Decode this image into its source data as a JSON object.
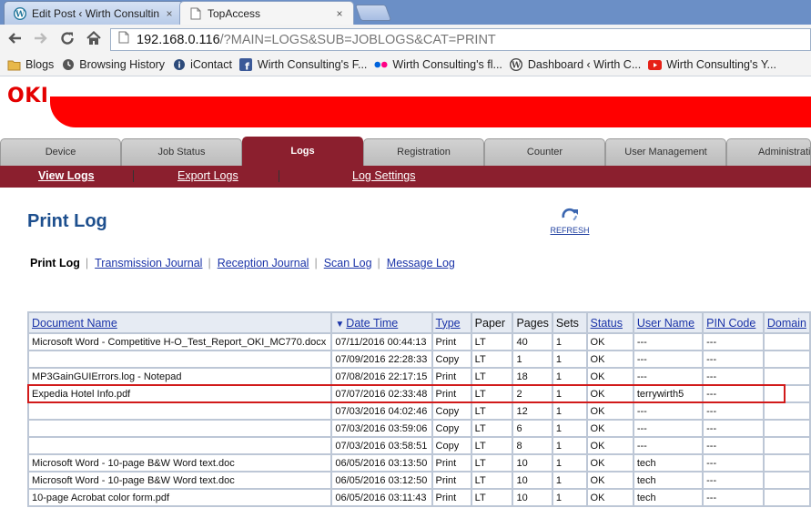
{
  "browser": {
    "tabs": [
      {
        "label": "Edit Post ‹ Wirth Consultin",
        "icon": "wordpress-icon"
      },
      {
        "label": "TopAccess",
        "icon": "page-icon"
      }
    ],
    "close_glyph": "×",
    "url_host": "192.168.0.116",
    "url_path": "/?MAIN=LOGS&SUB=JOBLOGS&CAT=PRINT",
    "bookmarks": [
      {
        "label": "Blogs",
        "icon": "folder-icon"
      },
      {
        "label": "Browsing History",
        "icon": "clock-icon"
      },
      {
        "label": "iContact",
        "icon": "icontact-icon"
      },
      {
        "label": "Wirth Consulting's F...",
        "icon": "facebook-icon"
      },
      {
        "label": "Wirth Consulting's fl...",
        "icon": "flickr-icon"
      },
      {
        "label": "Dashboard ‹ Wirth C...",
        "icon": "wordpress-icon"
      },
      {
        "label": "Wirth Consulting's Y...",
        "icon": "youtube-icon"
      }
    ]
  },
  "brand": {
    "logo": "OKI",
    "color": "#e40000",
    "bar_color": "#ff0000"
  },
  "main_tabs": [
    {
      "label": "Device"
    },
    {
      "label": "Job Status"
    },
    {
      "label": "Logs",
      "active": true
    },
    {
      "label": "Registration"
    },
    {
      "label": "Counter"
    },
    {
      "label": "User Management"
    },
    {
      "label": "Administration"
    }
  ],
  "sub_nav": [
    {
      "label": "View Logs",
      "active": true
    },
    {
      "label": "Export Logs"
    },
    {
      "label": "Log Settings"
    }
  ],
  "page_title": "Print Log",
  "refresh_label": "REFRESH",
  "log_types": {
    "current": "Print Log",
    "links": [
      "Transmission Journal",
      "Reception Journal",
      "Scan Log",
      "Message Log"
    ]
  },
  "table": {
    "columns": [
      {
        "label": "Document Name",
        "link": true
      },
      {
        "label": "Date Time",
        "link": true,
        "sorted": true
      },
      {
        "label": "Type",
        "link": true
      },
      {
        "label": "Paper",
        "link": false
      },
      {
        "label": "Pages",
        "link": false
      },
      {
        "label": "Sets",
        "link": false
      },
      {
        "label": "Status",
        "link": true
      },
      {
        "label": "User Name",
        "link": true
      },
      {
        "label": "PIN Code",
        "link": true
      },
      {
        "label": "Domain",
        "link": true
      }
    ],
    "rows": [
      [
        "Microsoft Word - Competitive H-O_Test_Report_OKI_MC770.docx",
        "07/11/2016 00:44:13",
        "Print",
        "LT",
        "40",
        "1",
        "OK",
        "---",
        "---",
        ""
      ],
      [
        "",
        "07/09/2016 22:28:33",
        "Copy",
        "LT",
        "1",
        "1",
        "OK",
        "---",
        "---",
        ""
      ],
      [
        "MP3GainGUIErrors.log - Notepad",
        "07/08/2016 22:17:15",
        "Print",
        "LT",
        "18",
        "1",
        "OK",
        "---",
        "---",
        ""
      ],
      [
        "Expedia Hotel Info.pdf",
        "07/07/2016 02:33:48",
        "Print",
        "LT",
        "2",
        "1",
        "OK",
        "terrywirth5",
        "---",
        ""
      ],
      [
        "",
        "07/03/2016 04:02:46",
        "Copy",
        "LT",
        "12",
        "1",
        "OK",
        "---",
        "---",
        ""
      ],
      [
        "",
        "07/03/2016 03:59:06",
        "Copy",
        "LT",
        "6",
        "1",
        "OK",
        "---",
        "---",
        ""
      ],
      [
        "",
        "07/03/2016 03:58:51",
        "Copy",
        "LT",
        "8",
        "1",
        "OK",
        "---",
        "---",
        ""
      ],
      [
        "Microsoft Word - 10-page B&W Word text.doc",
        "06/05/2016 03:13:50",
        "Print",
        "LT",
        "10",
        "1",
        "OK",
        "tech",
        "---",
        ""
      ],
      [
        "Microsoft Word - 10-page B&W Word text.doc",
        "06/05/2016 03:12:50",
        "Print",
        "LT",
        "10",
        "1",
        "OK",
        "tech",
        "---",
        ""
      ],
      [
        "10-page Acrobat color form.pdf",
        "06/05/2016 03:11:43",
        "Print",
        "LT",
        "10",
        "1",
        "OK",
        "tech",
        "---",
        ""
      ]
    ]
  }
}
